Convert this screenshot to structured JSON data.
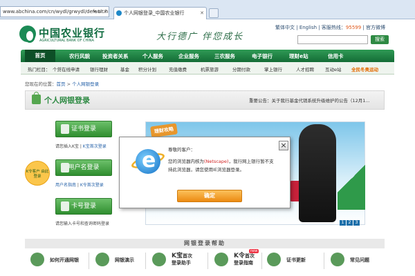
{
  "browser": {
    "address": "www.abchina.com/cn/wydl/grwydl/default.h",
    "address_controls": "▾ ↻ ✕",
    "tab_title": "个人网银登录_中国农业银行",
    "tab_close": "✕"
  },
  "header": {
    "bank_name": "中国农业银行",
    "bank_name_en": "AGRICULTURAL BANK OF CHINA",
    "slogan": "大行德广  伴您成长",
    "links": {
      "trad": "繁体中文",
      "english": "English",
      "hotline_label": "客服热线：",
      "hotline": "95599",
      "weibo": "官方微博"
    },
    "search_button": "搜索"
  },
  "nav": [
    "首页",
    "农行风貌",
    "投资者关系",
    "个人服务",
    "企业服务",
    "三农服务",
    "电子银行",
    "理财e站",
    "信用卡"
  ],
  "subnav": {
    "lead": "热门栏目：",
    "items": [
      "个贷在线申请",
      "银行理财",
      "基金",
      "积分计划",
      "充值缴费",
      "机票旅游",
      "分期付款",
      "掌上银行",
      "人才招聘",
      "互动e站"
    ],
    "special": "全民冬奥运动"
  },
  "breadcrumb": {
    "prefix": "您现在的位置：",
    "home": "首页",
    "sep": " > ",
    "current": "个人网银登录"
  },
  "login": {
    "title": "个人网银登录",
    "notice": "重要公告：关于我行基金代销系统升级维护的公告（12月1...",
    "cert_button": "证书登录",
    "cert_caption_pre": "请您插入K宝",
    "cert_caption_link": "K宝首次登录",
    "user_button": "用户名登录",
    "user_link1": "用户名指南",
    "user_link2": "K令首次登录",
    "card_button": "卡号登录",
    "card_caption": "请您输入卡号和查询密码登录",
    "ktag": "K令客户 由此登录"
  },
  "banner": {
    "tag": "理财攻略",
    "pages": [
      "1",
      "2",
      "3"
    ]
  },
  "dialog": {
    "greeting": "尊敬的客户：",
    "line1_pre": "您的浏览器内核为",
    "line1_browser": "(Netscape)",
    "line1_post": "，我行网上银行暂不支",
    "line2": "持此浏览器，请您使用IE浏览器登录。",
    "ok": "确定"
  },
  "help": {
    "title": "网银登录帮助",
    "items": [
      {
        "icon": "key-icon",
        "label": "如何开通网银"
      },
      {
        "icon": "monitor-icon",
        "label": "网银演示"
      },
      {
        "icon": "k-bao-icon",
        "label_big": "K宝",
        "label": "首次",
        "label2": "登录助手"
      },
      {
        "icon": "k-ling-icon",
        "label_big": "K令",
        "label": "首次",
        "label2": "登录指南",
        "badge": "new"
      },
      {
        "icon": "certificate-icon",
        "label": "证书更新"
      },
      {
        "icon": "question-icon",
        "label": "常见问题"
      }
    ]
  }
}
